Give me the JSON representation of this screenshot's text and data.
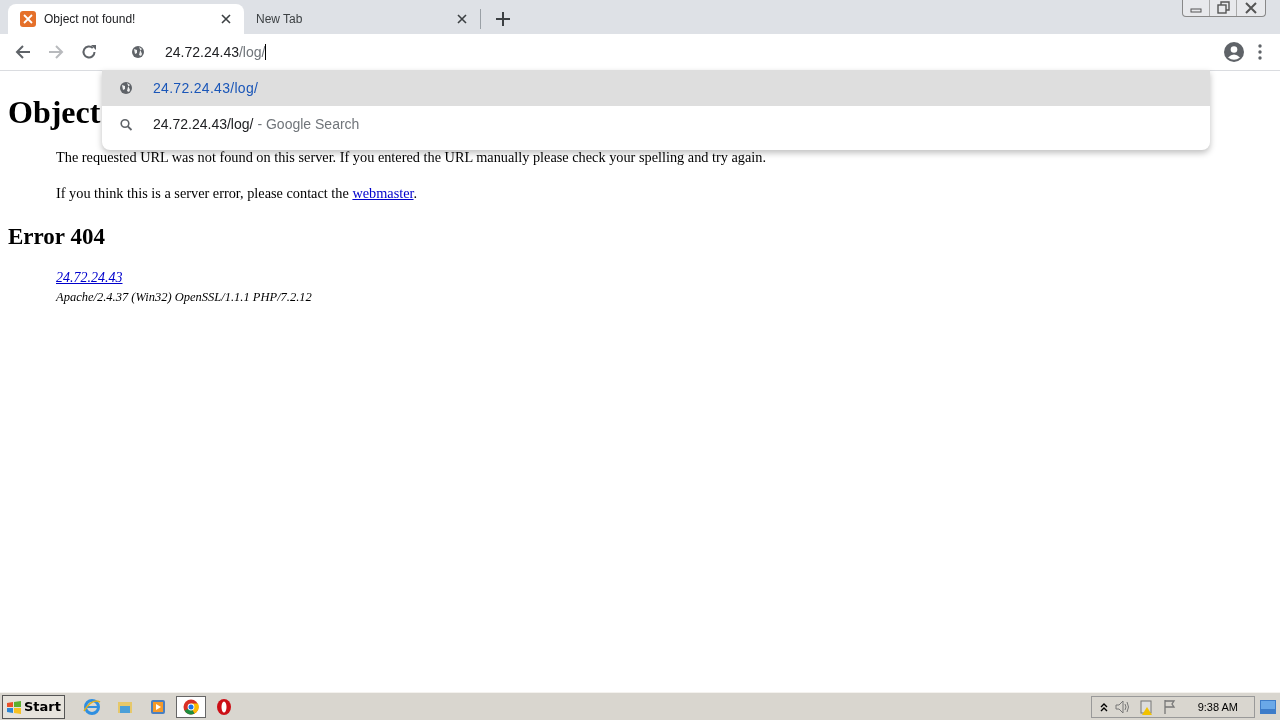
{
  "tabs": [
    {
      "title": "Object not found!",
      "selected": true,
      "kind": "xampp"
    },
    {
      "title": "New Tab",
      "selected": false,
      "kind": "blank"
    }
  ],
  "omnibox": {
    "host": "24.72.24.43",
    "path": "/log/"
  },
  "suggestions": [
    {
      "kind": "url",
      "text": "24.72.24.43/log/",
      "selected": true
    },
    {
      "kind": "search",
      "text": "24.72.24.43/log/",
      "suffix": "- Google Search",
      "selected": false
    }
  ],
  "page": {
    "heading": "Object",
    "paragraphs": [
      {
        "text": "The requested URL was not found on this server. If you entered the URL manually please check your spelling and try again."
      },
      {
        "text": "If you think this is a server error, please contact the ",
        "link": "webmaster",
        "after": "."
      }
    ],
    "error_heading": "Error 404",
    "address_link": "24.72.24.43",
    "server_signature": "Apache/2.4.37 (Win32) OpenSSL/1.1.1 PHP/7.2.12"
  },
  "taskbar": {
    "start": "Start",
    "apps": [
      {
        "kind": "ie",
        "selected": false
      },
      {
        "kind": "explorer",
        "selected": false
      },
      {
        "kind": "media",
        "selected": false
      },
      {
        "kind": "chrome",
        "selected": true
      },
      {
        "kind": "opera",
        "selected": false
      }
    ],
    "clock": "9:38 AM"
  }
}
